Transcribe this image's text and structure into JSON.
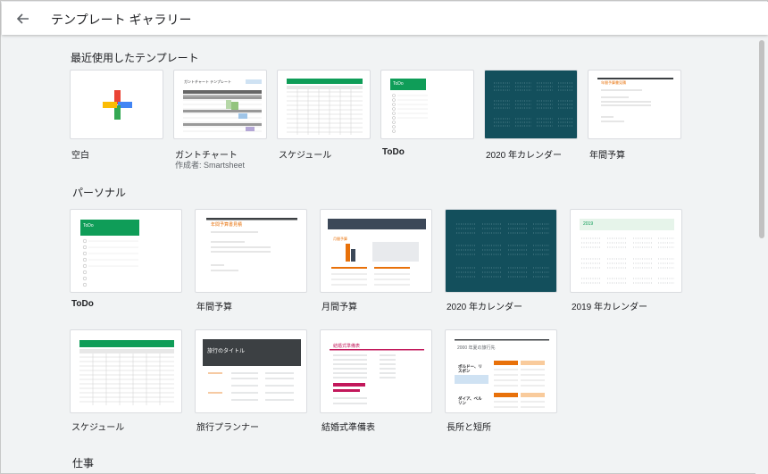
{
  "header": {
    "title": "テンプレート ギャラリー"
  },
  "recent": {
    "heading": "最近使用したテンプレート",
    "items": [
      {
        "label": "空白"
      },
      {
        "label": "ガントチャート",
        "sub": "作成者: Smartsheet",
        "thumb_title": "ガントチャート テンプレート"
      },
      {
        "label": "スケジュール"
      },
      {
        "label": "ToDo",
        "thumb_title": "ToDo"
      },
      {
        "label": "2020 年カレンダー"
      },
      {
        "label": "年間予算",
        "thumb_title": "年間予算書見積"
      }
    ]
  },
  "personal": {
    "heading": "パーソナル",
    "items": [
      {
        "label": "ToDo",
        "thumb_title": "ToDo"
      },
      {
        "label": "年間予算",
        "thumb_title": "年間予算書見積"
      },
      {
        "label": "月間予算",
        "thumb_title": "月間予算"
      },
      {
        "label": "2020 年カレンダー"
      },
      {
        "label": "2019 年カレンダー",
        "thumb_title": "2019"
      },
      {
        "label": "スケジュール"
      },
      {
        "label": "旅行プランナー",
        "thumb_title": "旅行のタイトル"
      },
      {
        "label": "結婚式準備表",
        "thumb_title": "結婚式準備表"
      },
      {
        "label": "長所と短所",
        "thumb_title": "2000 年夏の旅行先",
        "thumb_cells": [
          "ボルドー、リスボン",
          "ダイア、ベルリン"
        ]
      }
    ]
  },
  "work": {
    "heading": "仕事"
  },
  "colors": {
    "green": "#0f9d58",
    "teal": "#134f5c",
    "orange": "#e8710a",
    "brand_blue": "#4285f4",
    "brand_red": "#ea4335",
    "brand_yellow": "#fbbc04"
  }
}
